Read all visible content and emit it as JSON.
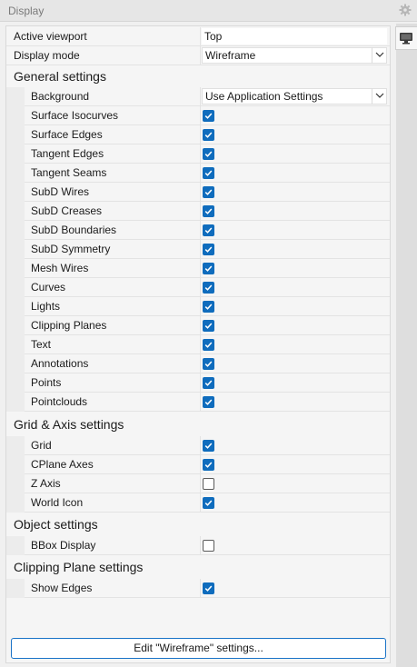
{
  "window": {
    "title": "Display",
    "gear_icon": "gear-icon",
    "side_tab_icon": "monitor-icon"
  },
  "viewport": {
    "label": "Active viewport",
    "value": "Top"
  },
  "display_mode": {
    "label": "Display mode",
    "value": "Wireframe"
  },
  "general": {
    "heading": "General settings",
    "background": {
      "label": "Background",
      "value": "Use Application Settings"
    },
    "items": [
      {
        "label": "Surface Isocurves",
        "checked": true
      },
      {
        "label": "Surface Edges",
        "checked": true
      },
      {
        "label": "Tangent Edges",
        "checked": true
      },
      {
        "label": "Tangent Seams",
        "checked": true
      },
      {
        "label": "SubD Wires",
        "checked": true
      },
      {
        "label": "SubD Creases",
        "checked": true
      },
      {
        "label": "SubD Boundaries",
        "checked": true
      },
      {
        "label": "SubD Symmetry",
        "checked": true
      },
      {
        "label": "Mesh Wires",
        "checked": true
      },
      {
        "label": "Curves",
        "checked": true
      },
      {
        "label": "Lights",
        "checked": true
      },
      {
        "label": "Clipping Planes",
        "checked": true
      },
      {
        "label": "Text",
        "checked": true
      },
      {
        "label": "Annotations",
        "checked": true
      },
      {
        "label": "Points",
        "checked": true
      },
      {
        "label": "Pointclouds",
        "checked": true
      }
    ]
  },
  "grid": {
    "heading": "Grid & Axis settings",
    "items": [
      {
        "label": "Grid",
        "checked": true
      },
      {
        "label": "CPlane Axes",
        "checked": true
      },
      {
        "label": "Z Axis",
        "checked": false
      },
      {
        "label": "World Icon",
        "checked": true
      }
    ]
  },
  "object": {
    "heading": "Object settings",
    "items": [
      {
        "label": "BBox Display",
        "checked": false
      }
    ]
  },
  "clipping": {
    "heading": "Clipping Plane settings",
    "items": [
      {
        "label": "Show Edges",
        "checked": true
      }
    ]
  },
  "edit_button": {
    "label": "Edit \"Wireframe\" settings..."
  },
  "colors": {
    "accent": "#0f6cbd",
    "button_border": "#1a73c7"
  }
}
